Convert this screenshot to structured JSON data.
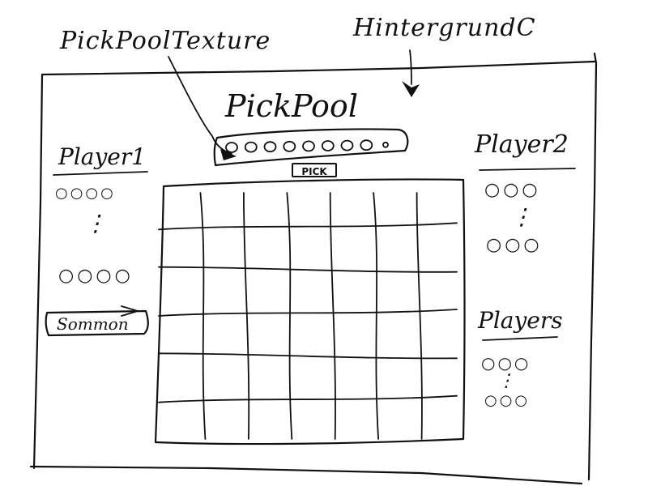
{
  "annotations": {
    "pick_pool_texture": "PickPoolTexture",
    "hintergrund": "HintergrundC"
  },
  "pick_pool": {
    "title": "PickPool",
    "slot_count": 9,
    "pick_button_label": "PICK"
  },
  "players": [
    {
      "name": "Player1",
      "top_row": "○○○○",
      "bottom_row": "○○○○",
      "ellipsis": "⋮",
      "button_label": "Sommon"
    },
    {
      "name": "Player2",
      "top_row": "○○○",
      "bottom_row": "○○○",
      "ellipsis": "⋮"
    },
    {
      "name": "Players",
      "top_row": "○○○",
      "bottom_row": "○○○",
      "ellipsis": "⋮"
    }
  ],
  "board": {
    "rows": 5,
    "columns": 6
  },
  "colors": {
    "ink": "#111111",
    "paper": "#ffffff"
  },
  "icons": {
    "arrow_to_pool": "curved-arrow-icon",
    "arrow_to_background": "down-arrow-icon"
  }
}
